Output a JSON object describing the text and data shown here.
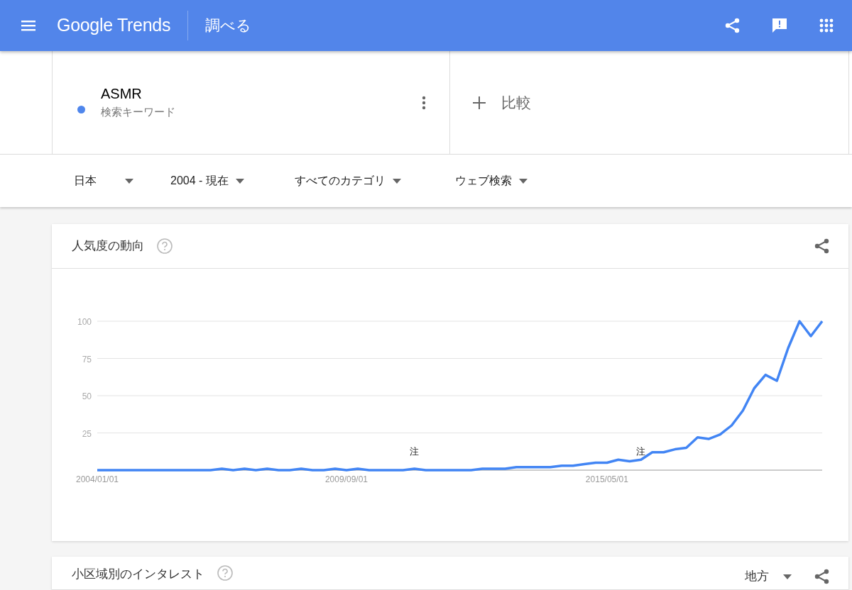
{
  "header": {
    "logo_text": "Google Trends",
    "page_title": "調べる"
  },
  "search_terms": [
    {
      "term": "ASMR",
      "subtitle": "検索キーワード",
      "color": "#4f86ec"
    }
  ],
  "compare": {
    "label": "比較"
  },
  "filters": [
    {
      "label": "日本"
    },
    {
      "label": "2004 - 現在"
    },
    {
      "label": "すべてのカテゴリ"
    },
    {
      "label": "ウェブ検索"
    }
  ],
  "sections": [
    {
      "title": "人気度の動向",
      "chart_data": {
        "type": "line",
        "categories": [
          "2004/01/01",
          null,
          null,
          null,
          null,
          null,
          null,
          null,
          null,
          null,
          null,
          null,
          null,
          null,
          null,
          null,
          null,
          null,
          null,
          null,
          null,
          null,
          "2009/09/01",
          null,
          null,
          null,
          null,
          null,
          null,
          null,
          null,
          null,
          null,
          null,
          null,
          null,
          null,
          null,
          null,
          null,
          null,
          null,
          null,
          null,
          null,
          "2015/05/01",
          null,
          null,
          null,
          null,
          null,
          null,
          null,
          null,
          null,
          null,
          null,
          null,
          null,
          null,
          null,
          null,
          null,
          null,
          null
        ],
        "series": [
          {
            "color": "#4285f4",
            "values": [
              0,
              0,
              0,
              0,
              0,
              0,
              0,
              0,
              0,
              0,
              0,
              1,
              0,
              1,
              0,
              1,
              0,
              0,
              1,
              0,
              0,
              1,
              0,
              1,
              0,
              0,
              0,
              0,
              1,
              0,
              0,
              0,
              0,
              0,
              1,
              1,
              1,
              2,
              2,
              2,
              2,
              3,
              3,
              4,
              5,
              5,
              7,
              6,
              7,
              12,
              12,
              14,
              15,
              22,
              21,
              24,
              30,
              40,
              55,
              64,
              60,
              82,
              100,
              90,
              100
            ]
          }
        ],
        "ylim": [
          0,
          100
        ],
        "yticks": [
          25,
          50,
          75,
          100
        ],
        "grid": true,
        "annotations": [
          "注",
          "注"
        ]
      }
    },
    {
      "title": "小区域別のインタレスト",
      "dropdown": "地方"
    }
  ]
}
